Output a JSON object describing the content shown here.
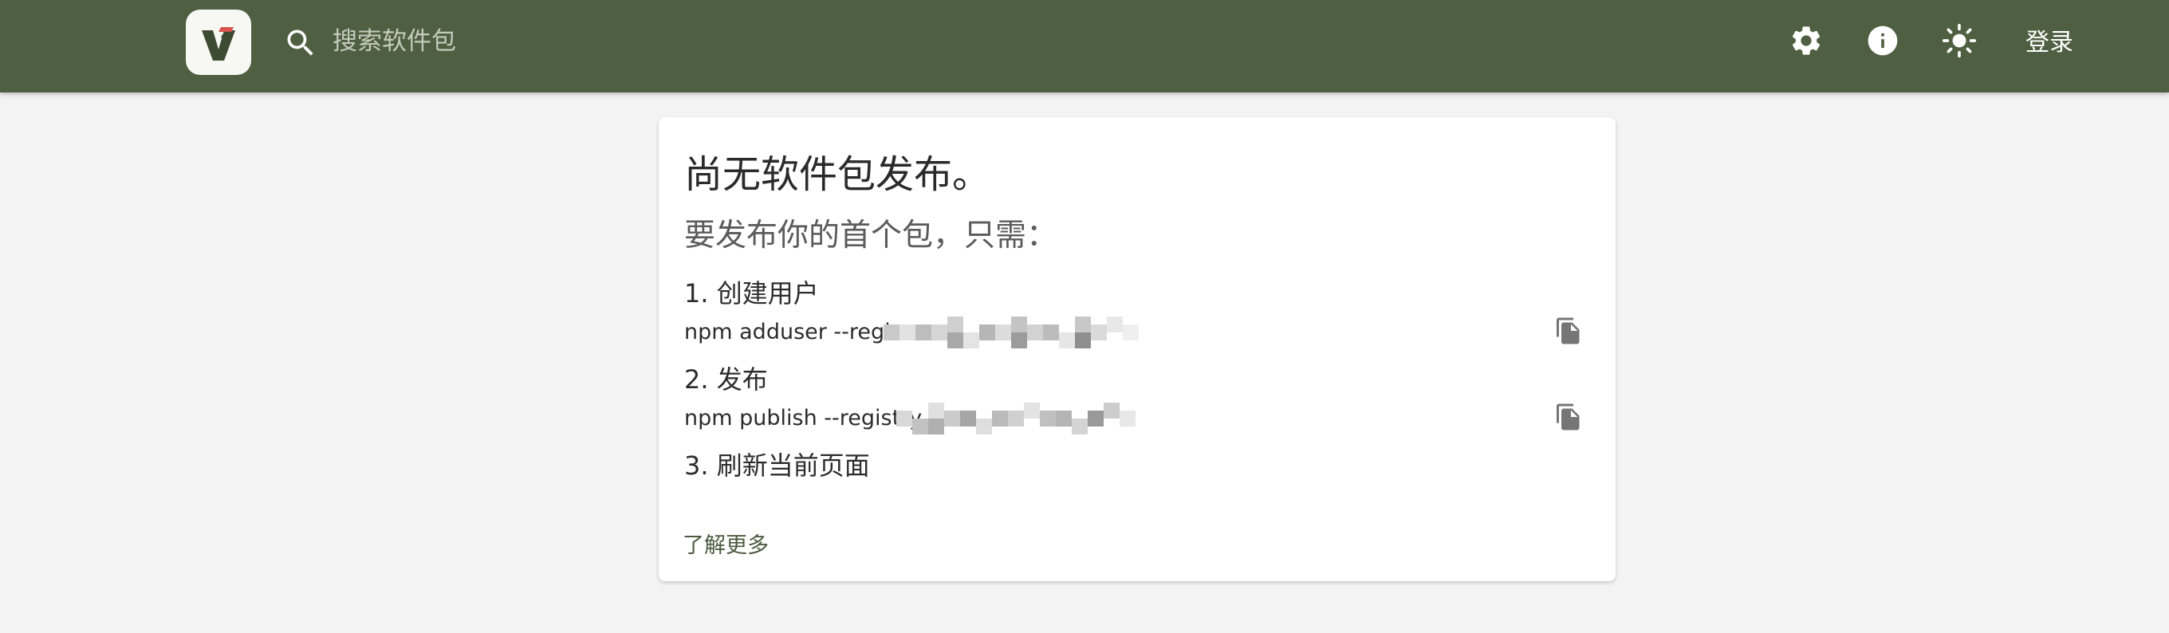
{
  "header": {
    "logo_name": "verdaccio-logo",
    "search": {
      "placeholder": "搜索软件包",
      "value": ""
    },
    "icons": [
      "gear-icon",
      "info-icon",
      "sun-icon"
    ],
    "login_label": "登录",
    "colors": {
      "header_bg": "#4f5f41",
      "page_bg": "#f3f3f3",
      "accent": "#4b5a3e"
    }
  },
  "card": {
    "title": "尚无软件包发布。",
    "subtitle": "要发布你的首个包，只需：",
    "steps": [
      {
        "label": "1. 创建用户",
        "command": "npm adduser --regis"
      },
      {
        "label": "2. 发布",
        "command": "npm publish --registry"
      },
      {
        "label": "3. 刷新当前页面"
      }
    ],
    "learn_more": "了解更多"
  }
}
